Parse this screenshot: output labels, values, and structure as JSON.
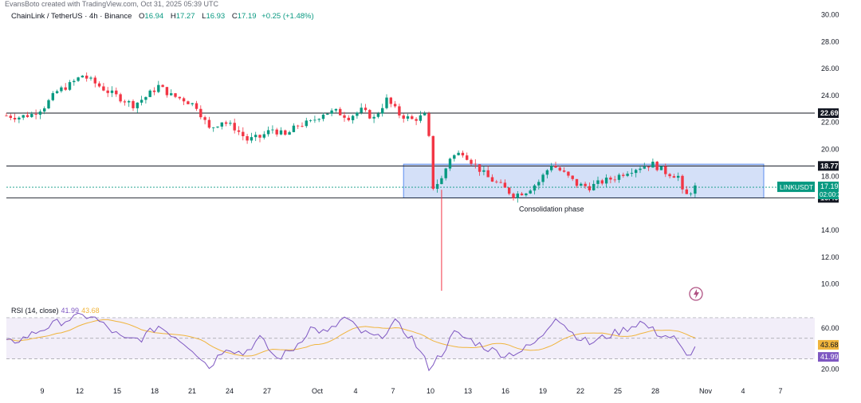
{
  "watermark": "EvansBoto created with TradingView.com, Oct 31, 2025 05:39 UTC",
  "header": {
    "symbol": "ChainLink / TetherUS · 4h · Binance",
    "open_label": "O",
    "open": "16.94",
    "high_label": "H",
    "high": "17.27",
    "low_label": "L",
    "low": "16.93",
    "close_label": "C",
    "close": "17.19",
    "change": "+0.25 (+1.48%)"
  },
  "colors": {
    "up": "#089981",
    "down": "#f23645",
    "rsi": "#7e57c2",
    "rsi_ma": "#f0b43c",
    "box": "#c5d6f5",
    "box_border": "#5b8def"
  },
  "chart_data": [
    {
      "type": "line",
      "subtype": "candlestick",
      "xlabel": "",
      "ylabel": "",
      "ylim": [
        8.5,
        30.5
      ],
      "y_ticks": [
        "30.00",
        "28.00",
        "26.00",
        "24.00",
        "22.00",
        "20.00",
        "18.00",
        "14.00",
        "12.00",
        "10.00"
      ],
      "x_ticks": [
        "9",
        "12",
        "15",
        "18",
        "21",
        "24",
        "27",
        "Oct",
        "4",
        "7",
        "10",
        "13",
        "16",
        "19",
        "22",
        "25",
        "28",
        "Nov",
        "4",
        "7"
      ],
      "close_path": [
        [
          0,
          22.5
        ],
        [
          3,
          22.4
        ],
        [
          6,
          22.6
        ],
        [
          9,
          23.2
        ],
        [
          12,
          24.3
        ],
        [
          15,
          24.8
        ],
        [
          18,
          25.5
        ],
        [
          21,
          24.9
        ],
        [
          24,
          24.3
        ],
        [
          27,
          23.8
        ],
        [
          30,
          23.3
        ],
        [
          33,
          23.9
        ],
        [
          36,
          24.7
        ],
        [
          39,
          24.0
        ],
        [
          42,
          23.7
        ],
        [
          45,
          23.2
        ],
        [
          48,
          21.5
        ],
        [
          51,
          22.1
        ],
        [
          54,
          21.6
        ],
        [
          57,
          20.7
        ],
        [
          60,
          20.9
        ],
        [
          63,
          21.5
        ],
        [
          66,
          21.0
        ],
        [
          69,
          21.8
        ],
        [
          72,
          22.0
        ],
        [
          75,
          22.7
        ],
        [
          78,
          22.8
        ],
        [
          81,
          22.4
        ],
        [
          84,
          22.9
        ],
        [
          87,
          22.3
        ],
        [
          90,
          23.7
        ],
        [
          93,
          22.6
        ],
        [
          96,
          22.2
        ],
        [
          99,
          22.5
        ],
        [
          100,
          20.8
        ],
        [
          101,
          17.2
        ],
        [
          103,
          17.8
        ],
        [
          105,
          19.4
        ],
        [
          108,
          19.8
        ],
        [
          111,
          18.8
        ],
        [
          114,
          17.9
        ],
        [
          117,
          17.3
        ],
        [
          120,
          16.6
        ],
        [
          123,
          16.9
        ],
        [
          126,
          17.6
        ],
        [
          129,
          18.9
        ],
        [
          132,
          18.2
        ],
        [
          135,
          17.4
        ],
        [
          138,
          17.2
        ],
        [
          141,
          17.6
        ],
        [
          144,
          17.9
        ],
        [
          147,
          18.4
        ],
        [
          150,
          18.7
        ],
        [
          153,
          18.9
        ],
        [
          156,
          18.3
        ],
        [
          159,
          18.0
        ],
        [
          160,
          16.8
        ],
        [
          161,
          16.6
        ],
        [
          163,
          17.19
        ]
      ],
      "horizontal_levels": [
        {
          "value": 22.69,
          "label": "22.69"
        },
        {
          "value": 18.77,
          "label": "18.77"
        },
        {
          "value": 16.4,
          "label": "16.40"
        }
      ],
      "current_price": {
        "label": "LINKUSDT",
        "value": "17.19",
        "countdown": "02:00:39"
      },
      "wick_low": 9.5,
      "consolidation_box": {
        "top": 18.9,
        "bottom": 16.4,
        "label": "Consolidation phase"
      }
    },
    {
      "type": "line",
      "name": "RSI (14, close)",
      "rsi_value": "41.99",
      "rsi_ma_value": "43.68",
      "ylim": [
        15,
        80
      ],
      "y_ticks": [
        "60.00",
        "20.00"
      ],
      "bands": [
        70,
        50,
        30
      ],
      "path": [
        [
          0,
          45
        ],
        [
          4,
          50
        ],
        [
          8,
          58
        ],
        [
          12,
          65
        ],
        [
          16,
          70
        ],
        [
          20,
          72
        ],
        [
          24,
          60
        ],
        [
          28,
          48
        ],
        [
          32,
          50
        ],
        [
          36,
          62
        ],
        [
          40,
          52
        ],
        [
          44,
          40
        ],
        [
          48,
          22
        ],
        [
          52,
          42
        ],
        [
          56,
          35
        ],
        [
          60,
          50
        ],
        [
          64,
          30
        ],
        [
          68,
          40
        ],
        [
          72,
          60
        ],
        [
          76,
          55
        ],
        [
          80,
          70
        ],
        [
          84,
          56
        ],
        [
          88,
          50
        ],
        [
          92,
          65
        ],
        [
          96,
          50
        ],
        [
          100,
          22
        ],
        [
          103,
          35
        ],
        [
          106,
          55
        ],
        [
          110,
          48
        ],
        [
          114,
          40
        ],
        [
          118,
          34
        ],
        [
          122,
          38
        ],
        [
          126,
          48
        ],
        [
          130,
          72
        ],
        [
          134,
          55
        ],
        [
          138,
          45
        ],
        [
          142,
          52
        ],
        [
          146,
          58
        ],
        [
          150,
          66
        ],
        [
          154,
          55
        ],
        [
          158,
          50
        ],
        [
          161,
          32
        ],
        [
          163,
          41.99
        ]
      ]
    }
  ],
  "rsi_right_labels": {
    "top": "60.00",
    "ma": "43.68",
    "rsi": "41.99",
    "bottom": "20.00"
  }
}
